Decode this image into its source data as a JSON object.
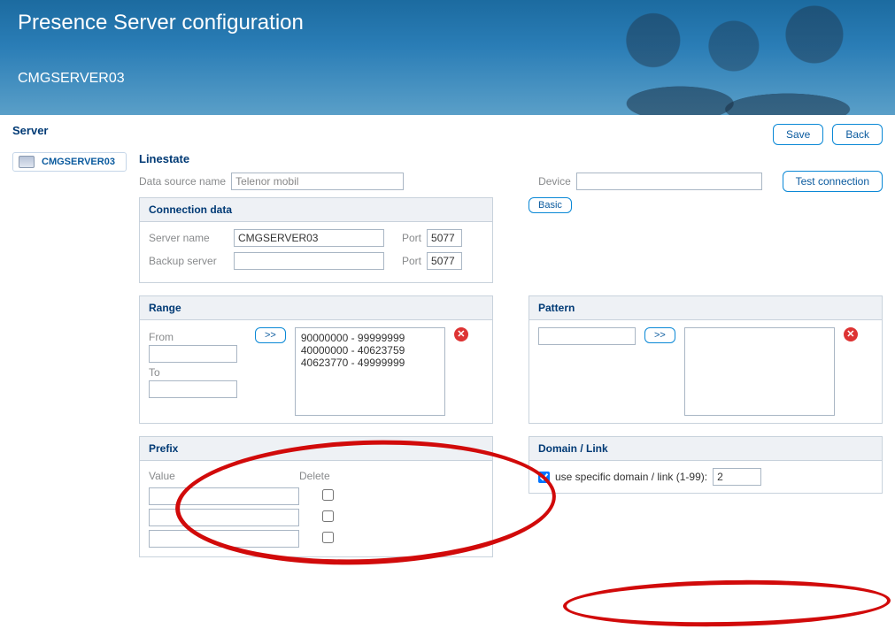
{
  "banner": {
    "title": "Presence Server configuration",
    "subtitle": "CMGSERVER03"
  },
  "server_heading": "Server",
  "buttons": {
    "save": "Save",
    "back": "Back",
    "test_connection": "Test connection",
    "basic": "Basic",
    "add": ">>"
  },
  "server_item": {
    "name": "CMGSERVER03"
  },
  "linestate": {
    "title": "Linestate",
    "ds_label": "Data source name",
    "ds_value": "Telenor mobil",
    "device_label": "Device",
    "device_value": ""
  },
  "connection": {
    "title": "Connection data",
    "server_name_label": "Server name",
    "server_name_value": "CMGSERVER03",
    "port_label": "Port",
    "port1": "5077",
    "backup_label": "Backup server",
    "backup_value": "",
    "port2": "5077"
  },
  "range": {
    "title": "Range",
    "from_label": "From",
    "to_label": "To",
    "from_value": "",
    "to_value": "",
    "items": [
      "90000000 - 99999999",
      "40000000 - 40623759",
      "40623770 - 49999999"
    ]
  },
  "pattern": {
    "title": "Pattern",
    "value": ""
  },
  "prefix": {
    "title": "Prefix",
    "value_label": "Value",
    "delete_label": "Delete",
    "rows": [
      {
        "value": "",
        "delete": false
      },
      {
        "value": "",
        "delete": false
      },
      {
        "value": "",
        "delete": false
      }
    ]
  },
  "domain": {
    "title": "Domain / Link",
    "checkbox_label": "use specific domain / link (1-99):",
    "checked": true,
    "value": "2"
  }
}
